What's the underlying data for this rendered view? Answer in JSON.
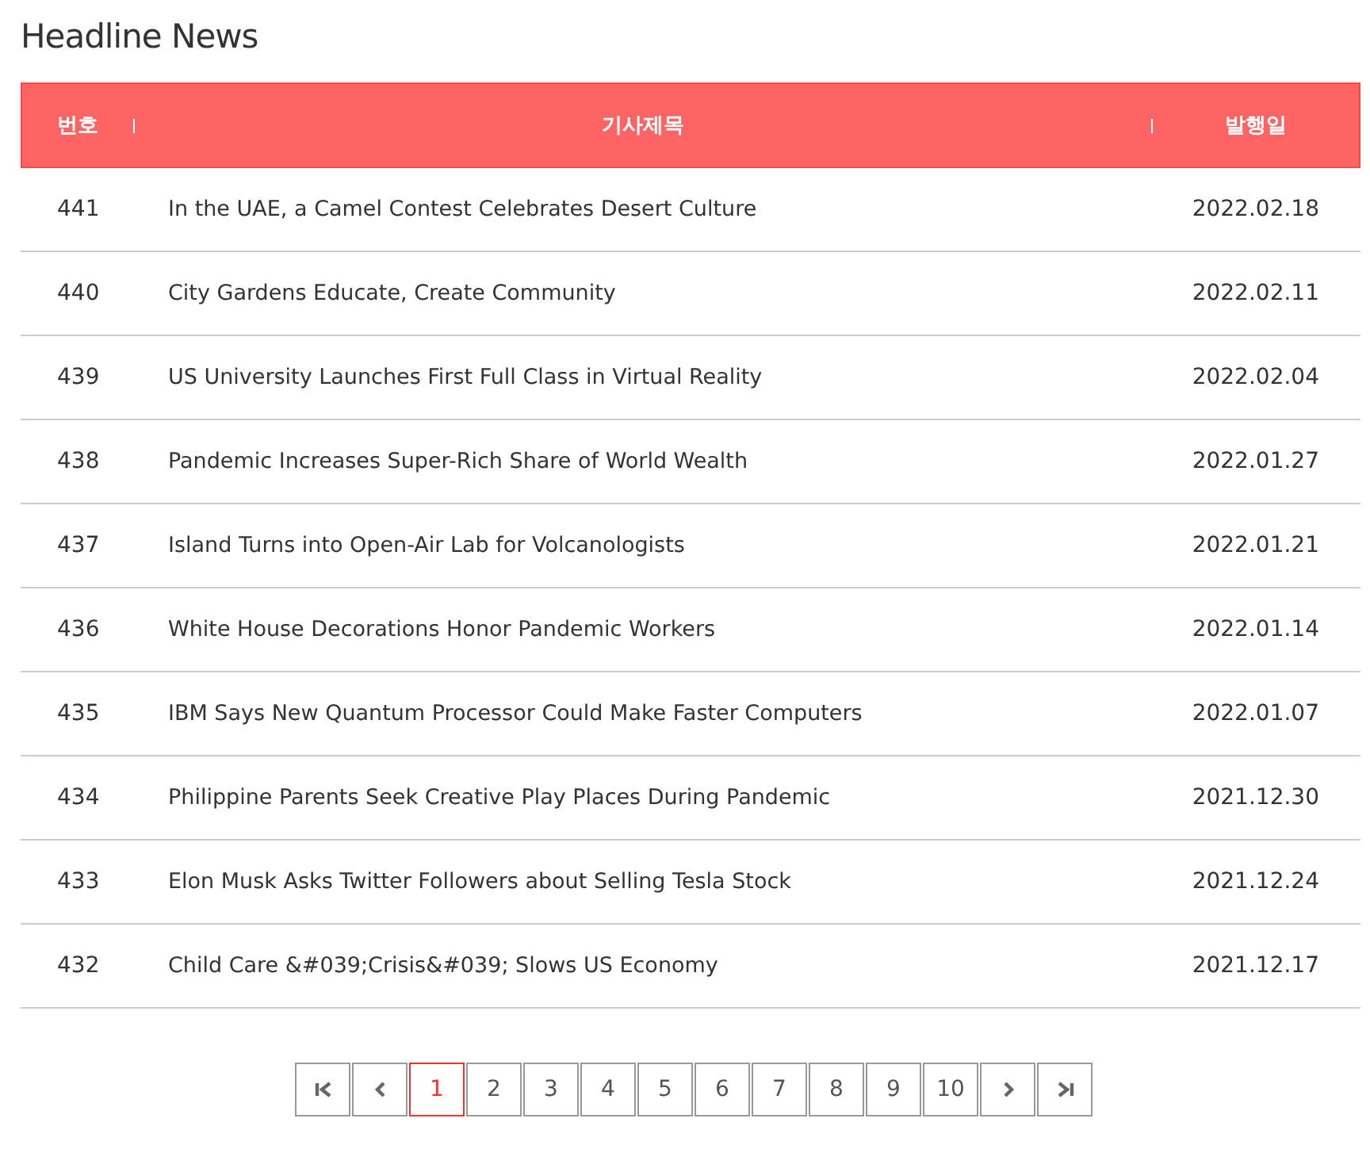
{
  "title": "Headline News",
  "table": {
    "columns": [
      "번호",
      "기사제목",
      "발행일"
    ],
    "rows": [
      {
        "number": "441",
        "title": "In the UAE, a Camel Contest Celebrates Desert Culture",
        "date": "2022.02.18"
      },
      {
        "number": "440",
        "title": "City Gardens Educate, Create Community",
        "date": "2022.02.11"
      },
      {
        "number": "439",
        "title": "US University Launches First Full Class in Virtual Reality",
        "date": "2022.02.04"
      },
      {
        "number": "438",
        "title": "Pandemic Increases Super-Rich Share of World Wealth",
        "date": "2022.01.27"
      },
      {
        "number": "437",
        "title": "Island Turns into Open-Air Lab for Volcanologists",
        "date": "2022.01.21"
      },
      {
        "number": "436",
        "title": "White House Decorations Honor Pandemic Workers",
        "date": "2022.01.14"
      },
      {
        "number": "435",
        "title": "IBM Says New Quantum Processor Could Make Faster Computers",
        "date": "2022.01.07"
      },
      {
        "number": "434",
        "title": "Philippine Parents Seek Creative Play Places During Pandemic",
        "date": "2021.12.30"
      },
      {
        "number": "433",
        "title": "Elon Musk Asks Twitter Followers about Selling Tesla Stock",
        "date": "2021.12.24"
      },
      {
        "number": "432",
        "title": "Child Care &#039;Crisis&#039; Slows US Economy",
        "date": "2021.12.17"
      }
    ]
  },
  "pagination": {
    "pages": [
      {
        "label": "1",
        "selected": true
      },
      {
        "label": "2",
        "selected": false
      },
      {
        "label": "3",
        "selected": false
      },
      {
        "label": "4",
        "selected": false
      },
      {
        "label": "5",
        "selected": false
      },
      {
        "label": "6",
        "selected": false
      },
      {
        "label": "7",
        "selected": false
      },
      {
        "label": "8",
        "selected": false
      },
      {
        "label": "9",
        "selected": false
      },
      {
        "label": "10",
        "selected": false
      }
    ]
  }
}
